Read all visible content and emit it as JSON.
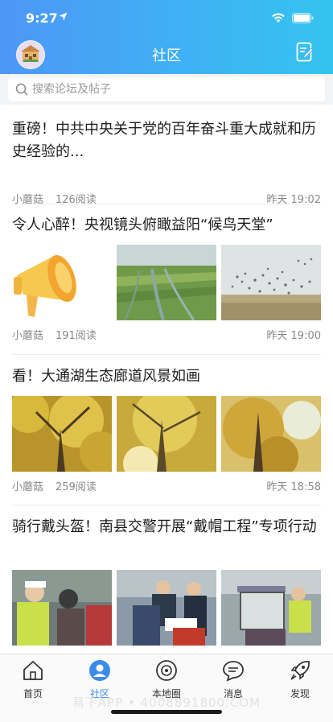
{
  "status": {
    "time": "9:27"
  },
  "nav": {
    "title": "社区"
  },
  "search": {
    "placeholder": "搜索论坛及帖子"
  },
  "posts": [
    {
      "title": "重磅！中共中央关于党的百年奋斗重大成就和历史经验的...",
      "author": "小蘑菇",
      "reads": "126阅读",
      "date": "昨天 19:02",
      "images": []
    },
    {
      "title": "令人心醉！央视镜头俯瞰益阳“候鸟天堂”",
      "author": "小蘑菇",
      "reads": "191阅读",
      "date": "昨天 19:00",
      "images": [
        "megaphone-graphic",
        "aerial-wetland-photo",
        "flying-birds-photo"
      ]
    },
    {
      "title": "看！大通湖生态廊道风景如画",
      "author": "小蘑菇",
      "reads": "259阅读",
      "date": "昨天 18:58",
      "images": [
        "ginkgo-tree-photo",
        "ginkgo-sunlight-photo",
        "ginkgo-sky-photo"
      ]
    },
    {
      "title": "骑行戴头盔！南县交警开展“戴帽工程”专项行动",
      "images": [
        "police-helmet-check-photo",
        "police-crowd-photo",
        "police-scooter-photo"
      ]
    }
  ],
  "tabs": [
    {
      "label": "首页",
      "icon": "home-icon"
    },
    {
      "label": "社区",
      "icon": "community-icon",
      "active": true
    },
    {
      "label": "本地圈",
      "icon": "local-circle-icon"
    },
    {
      "label": "消息",
      "icon": "message-icon"
    },
    {
      "label": "发现",
      "icon": "rocket-icon"
    }
  ],
  "watermark": "易下APP • 4008891800.COM",
  "colors": {
    "header_start": "#4d97f6",
    "header_end": "#35c3ee",
    "active_tab": "#3b8bea"
  }
}
